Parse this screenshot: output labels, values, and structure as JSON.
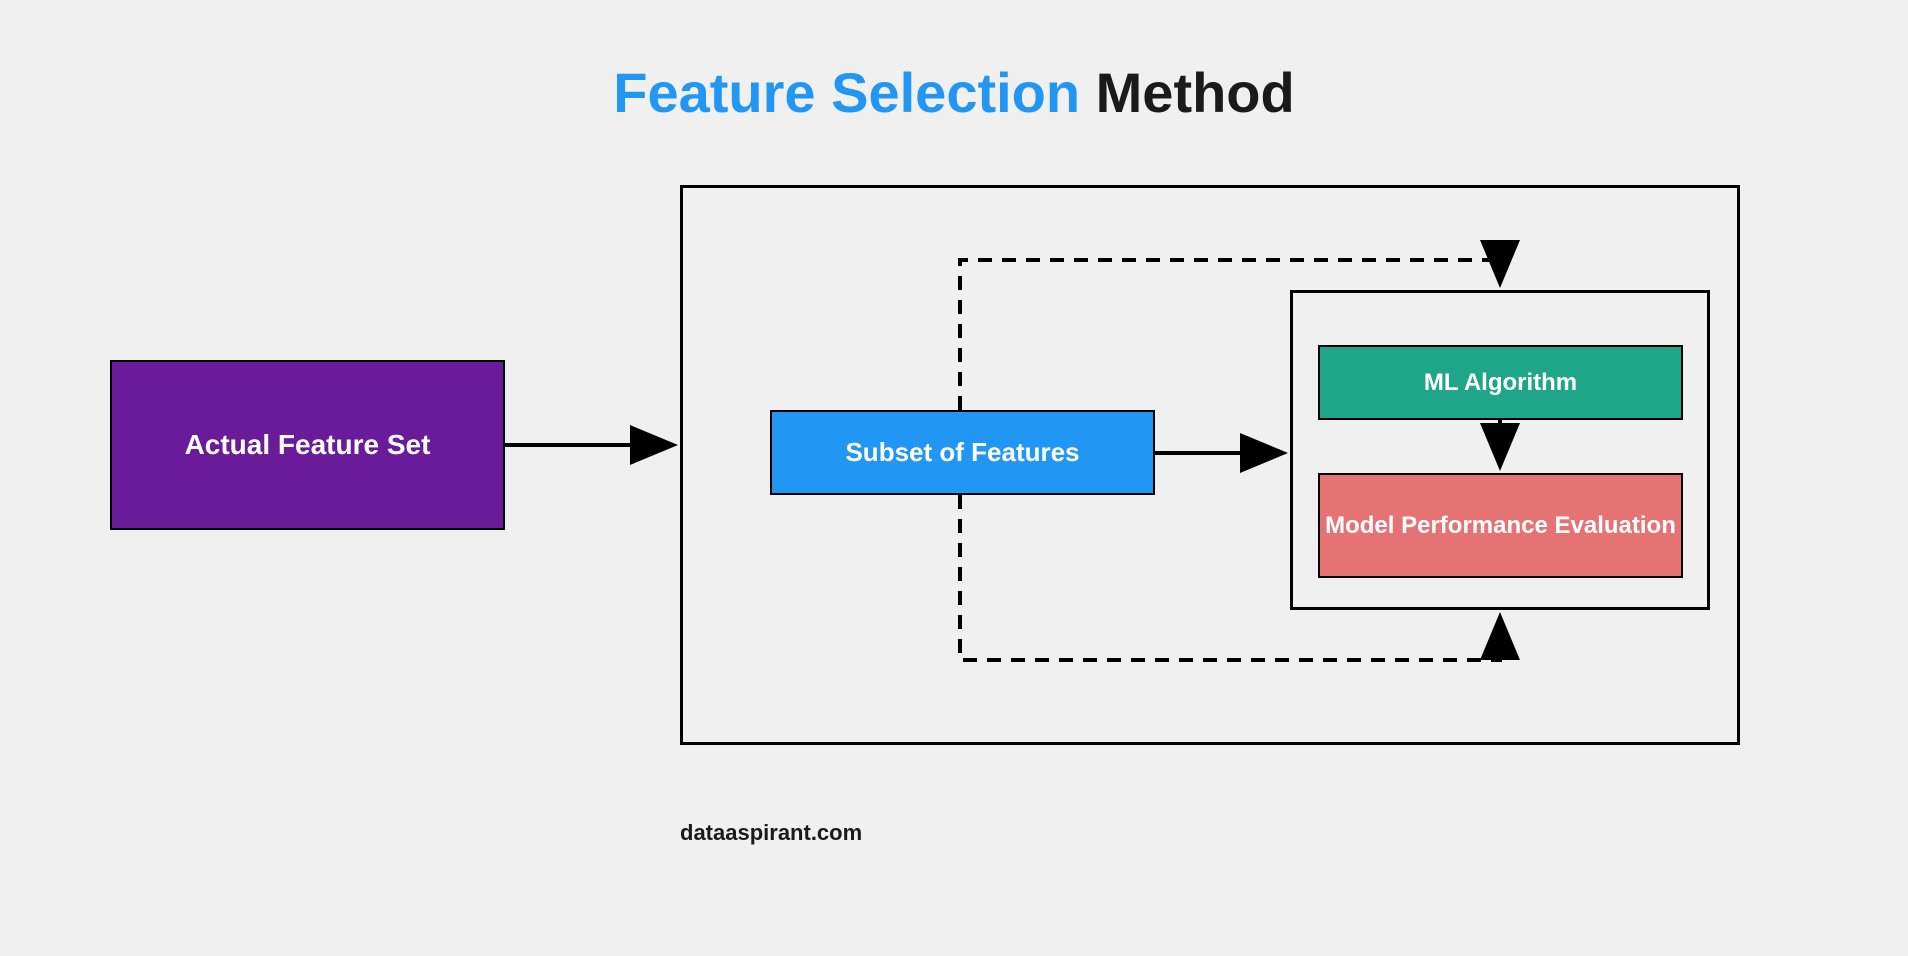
{
  "title": {
    "highlight": "Feature Selection",
    "normal": " Method"
  },
  "boxes": {
    "actual_feature_set": "Actual Feature Set",
    "subset_of_features": "Subset of Features",
    "ml_algorithm": "ML Algorithm",
    "model_performance": "Model Performance Evaluation"
  },
  "attribution": "dataaspirant.com",
  "colors": {
    "purple": "#6a1b9a",
    "blue": "#2196F3",
    "green": "#1fa588",
    "red": "#e57373"
  }
}
